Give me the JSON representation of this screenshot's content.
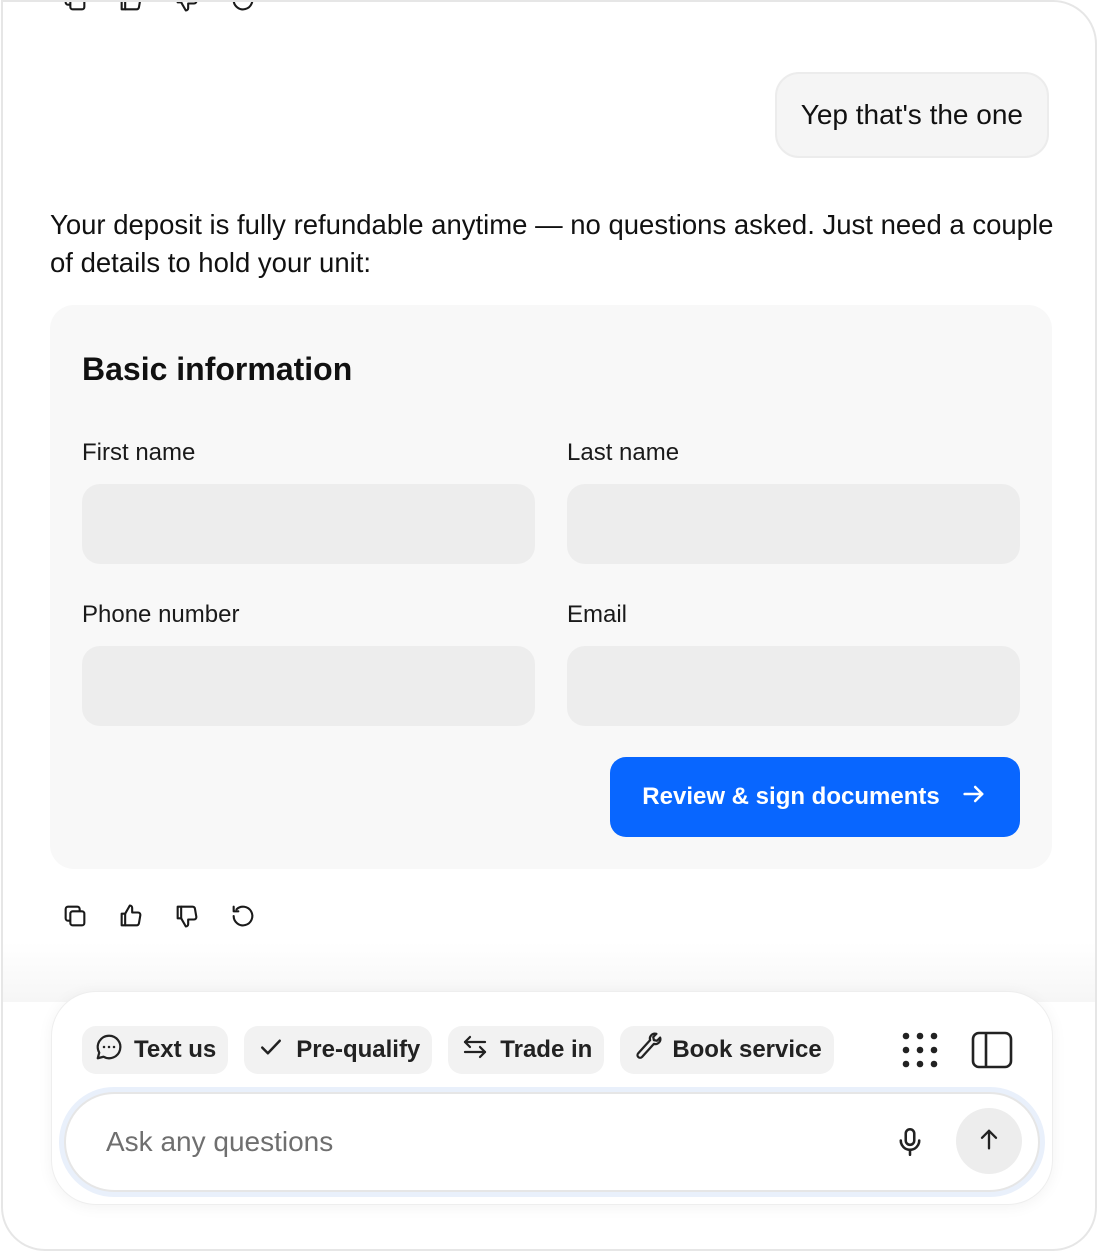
{
  "conversation": {
    "user_message": "Yep that's the one",
    "assistant_message": "Your deposit is fully refundable anytime — no questions asked. Just need a couple of details to hold your unit:"
  },
  "form": {
    "title": "Basic information",
    "first_name_label": "First name",
    "first_name_value": "",
    "last_name_label": "Last name",
    "last_name_value": "",
    "phone_label": "Phone number",
    "phone_value": "",
    "email_label": "Email",
    "email_value": "",
    "submit_label": "Review & sign documents"
  },
  "message_actions": [
    "copy-icon",
    "thumbs-up-icon",
    "thumbs-down-icon",
    "regenerate-icon"
  ],
  "composer": {
    "chips": [
      {
        "label": "Text us",
        "icon": "chat-bubble-icon"
      },
      {
        "label": "Pre-qualify",
        "icon": "check-icon"
      },
      {
        "label": "Trade in",
        "icon": "swap-arrows-icon"
      },
      {
        "label": "Book service",
        "icon": "wrench-icon"
      }
    ],
    "placeholder": "Ask any questions",
    "value": ""
  },
  "colors": {
    "accent": "#0866ff",
    "card_bg": "#f8f8f8",
    "input_bg": "#ededed",
    "bubble_bg": "#f5f5f5"
  }
}
